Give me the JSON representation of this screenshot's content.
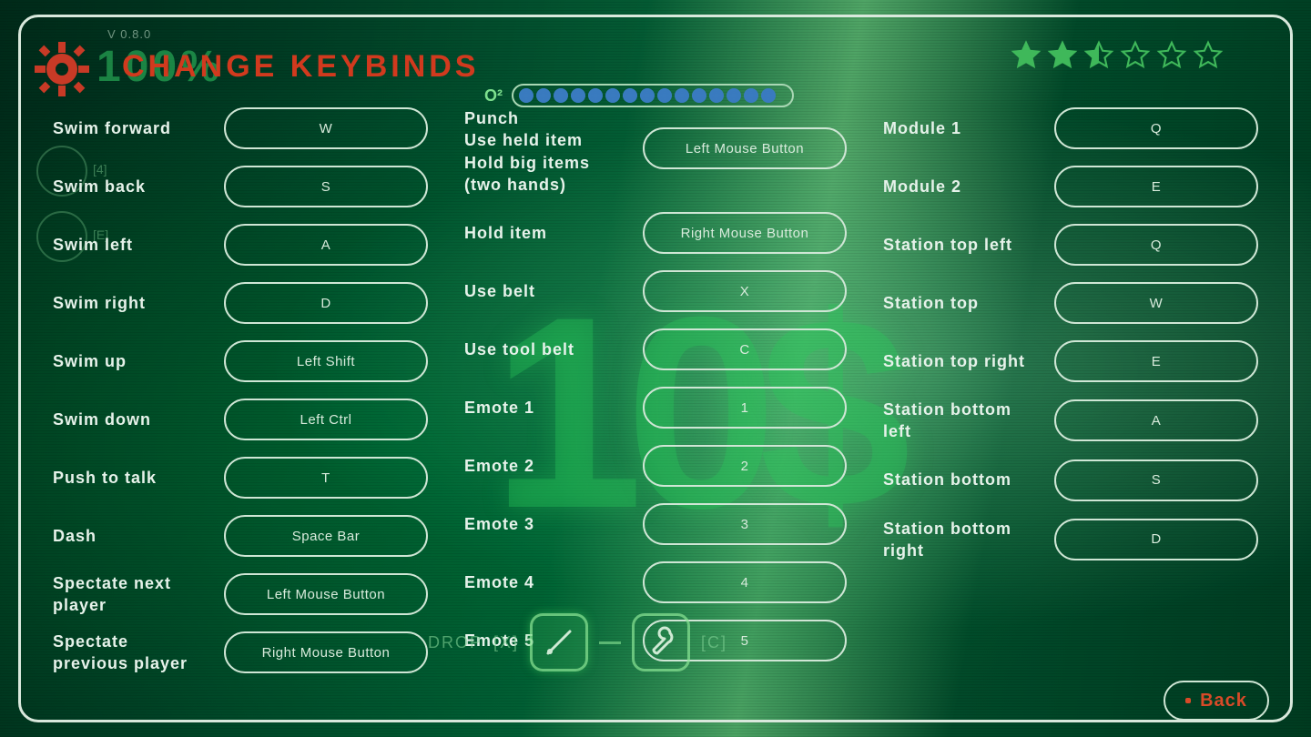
{
  "version_label": "V 0.8.0",
  "hud_percent": "100%",
  "title": "CHANGE KEYBINDS",
  "stars_filled": 2.5,
  "stars_total": 6,
  "o2_label": "O²",
  "o2_dots": 15,
  "back_label": "Back",
  "hud_tools_drop": "DROP",
  "hud_tools_x": "[X]",
  "hud_tools_c": "[C]",
  "columns": {
    "left": [
      {
        "label": "Swim forward",
        "key": "W"
      },
      {
        "label": "Swim back",
        "key": "S"
      },
      {
        "label": "Swim left",
        "key": "A"
      },
      {
        "label": "Swim right",
        "key": "D"
      },
      {
        "label": "Swim up",
        "key": "Left Shift"
      },
      {
        "label": "Swim down",
        "key": "Left Ctrl"
      },
      {
        "label": "Push to talk",
        "key": "T"
      },
      {
        "label": "Dash",
        "key": "Space Bar"
      },
      {
        "label": "Spectate next player",
        "key": "Left Mouse Button"
      },
      {
        "label": "Spectate previous player",
        "key": "Right Mouse Button"
      }
    ],
    "mid": [
      {
        "label": "Punch\nUse held item\nHold big items (two hands)",
        "key": "Left Mouse Button",
        "tall": true
      },
      {
        "label": "Hold item",
        "key": "Right Mouse Button"
      },
      {
        "label": "Use belt",
        "key": "X"
      },
      {
        "label": "Use tool belt",
        "key": "C"
      },
      {
        "label": "Emote 1",
        "key": "1"
      },
      {
        "label": "Emote 2",
        "key": "2"
      },
      {
        "label": "Emote 3",
        "key": "3"
      },
      {
        "label": "Emote 4",
        "key": "4"
      },
      {
        "label": "Emote 5",
        "key": "5"
      }
    ],
    "right": [
      {
        "label": "Module 1",
        "key": "Q"
      },
      {
        "label": "Module 2",
        "key": "E"
      },
      {
        "label": "Station top left",
        "key": "Q"
      },
      {
        "label": "Station top",
        "key": "W"
      },
      {
        "label": "Station top right",
        "key": "E"
      },
      {
        "label": "Station bottom left",
        "key": "A"
      },
      {
        "label": "Station bottom",
        "key": "S"
      },
      {
        "label": "Station bottom right",
        "key": "D"
      }
    ]
  }
}
